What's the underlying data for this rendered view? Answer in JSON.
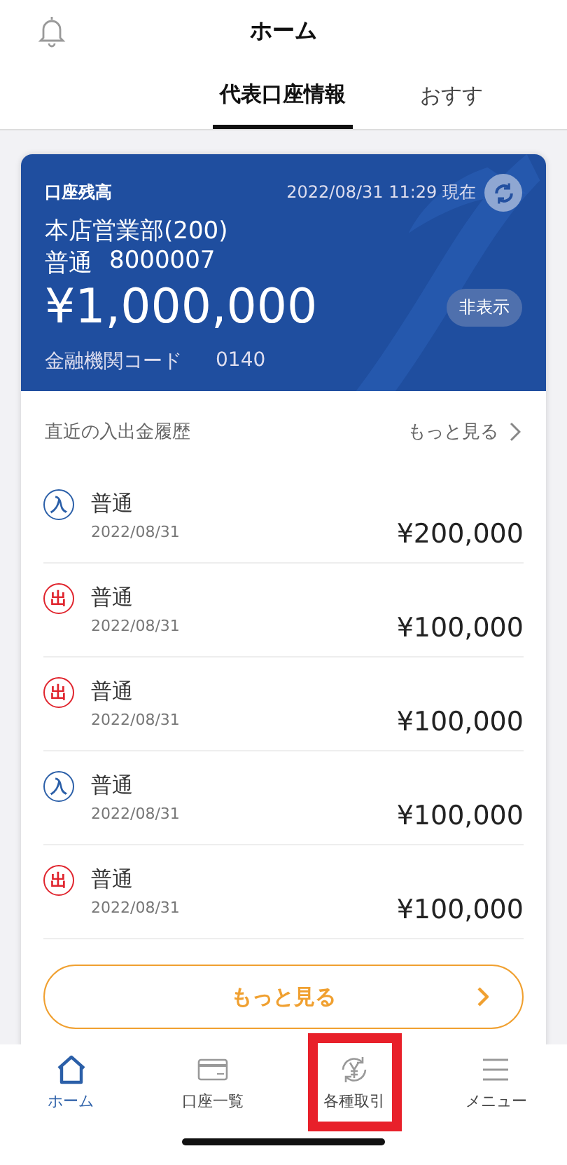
{
  "header": {
    "title": "ホーム"
  },
  "tabs": [
    {
      "label": "代表口座情報",
      "selected": true
    },
    {
      "label": "おすす",
      "selected": false
    }
  ],
  "balance_card": {
    "label": "口座残高",
    "timestamp": "2022/08/31 11:29 現在",
    "branch": "本店営業部(200)",
    "account_type": "普通",
    "account_number": "8000007",
    "balance": "¥1,000,000",
    "hide_button": "非表示",
    "bank_code_label": "金融機関コード",
    "bank_code": "0140"
  },
  "history": {
    "title": "直近の入出金履歴",
    "more_link": "もっと見る",
    "rows": [
      {
        "kind": "in",
        "badge": "入",
        "name": "普通",
        "date": "2022/08/31",
        "amount": "¥200,000"
      },
      {
        "kind": "out",
        "badge": "出",
        "name": "普通",
        "date": "2022/08/31",
        "amount": "¥100,000"
      },
      {
        "kind": "out",
        "badge": "出",
        "name": "普通",
        "date": "2022/08/31",
        "amount": "¥100,000"
      },
      {
        "kind": "in",
        "badge": "入",
        "name": "普通",
        "date": "2022/08/31",
        "amount": "¥100,000"
      },
      {
        "kind": "out",
        "badge": "出",
        "name": "普通",
        "date": "2022/08/31",
        "amount": "¥100,000"
      }
    ],
    "more_button": "もっと見る"
  },
  "bottom_nav": [
    {
      "kind": "home",
      "label": "ホーム",
      "selected": true,
      "highlighted": false
    },
    {
      "kind": "card",
      "label": "口座一覧",
      "selected": false,
      "highlighted": false
    },
    {
      "kind": "yen",
      "label": "各種取引",
      "selected": false,
      "highlighted": true
    },
    {
      "kind": "menu",
      "label": "メニュー",
      "selected": false,
      "highlighted": false
    }
  ]
}
